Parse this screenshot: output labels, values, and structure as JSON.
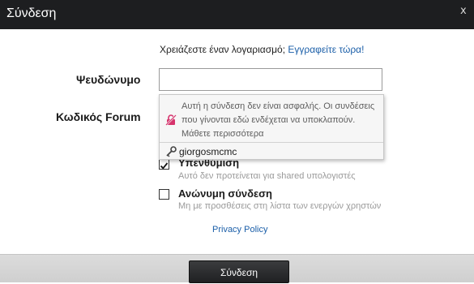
{
  "dialog": {
    "title": "Σύνδεση",
    "close_label": "x"
  },
  "register": {
    "prompt": "Χρειάζεστε έναν λογαριασμό;",
    "link": "Εγγραφείτε τώρα!"
  },
  "username": {
    "label": "Ψευδώνυμο",
    "value": ""
  },
  "password": {
    "label": "Κωδικός Forum"
  },
  "autofill": {
    "warning": "Αυτή η σύνδεση δεν είναι ασφαλής. Οι συνδέσεις που γίνονται εδώ ενδέχεται να υποκλαπούν. Μάθετε περισσότερα",
    "saved_login": "giorgosmcmc",
    "warning_icon": "insecure-lock-icon",
    "login_icon": "key-icon"
  },
  "remember": {
    "label": "Υπενθύμιση",
    "hint": "Αυτό δεν προτείνεται για shared υπολογιστές",
    "checked": true
  },
  "anonymous": {
    "label": "Ανώνυμη σύνδεση",
    "hint": "Μη με προσθέσεις στη λίστα των ενεργών χρηστών",
    "checked": false
  },
  "privacy_link": "Privacy Policy",
  "submit_label": "Σύνδεση",
  "colors": {
    "link": "#1a5ea8",
    "titlebar": "#1d1e20",
    "warning": "#d6336c"
  }
}
